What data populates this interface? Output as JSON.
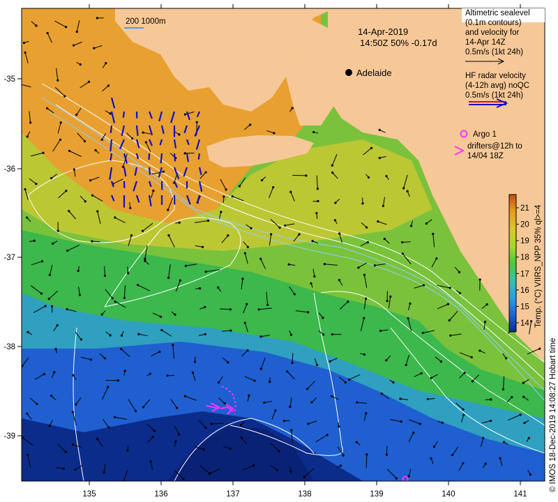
{
  "date_label": "14-Apr-2019",
  "time_label": "14:50Z  50% -0.17d",
  "scale_bar_label": "200  1000m",
  "city": {
    "name": "Adelaide"
  },
  "legend": {
    "altimetric": [
      "Altimetric sealevel",
      "(0.1m contours)",
      "and velocity for",
      "14-Apr 14Z",
      "0.5m/s (1kt 24h)"
    ],
    "hf_radar": [
      "HF radar velocity",
      "(4-12h avg) noQC",
      "0.5m/s (1kt 24h)"
    ],
    "argo": "Argo 1",
    "drifters": [
      "drifters@12h to",
      "14/04 18Z"
    ]
  },
  "colorbar": {
    "label": "Temp. (°C) VIIRS_NPP 35% ql>=4",
    "ticks": [
      "14",
      "15",
      "16",
      "17",
      "18",
      "19",
      "20",
      "21"
    ],
    "colors": [
      "#0b2c8a",
      "#1f5fd0",
      "#2f9fe0",
      "#3cc0a8",
      "#4cc83a",
      "#a6d82a",
      "#d8c828",
      "#e89a20",
      "#c05010"
    ]
  },
  "axes": {
    "x_ticks": [
      "135",
      "136",
      "137",
      "138",
      "139",
      "140",
      "141"
    ],
    "y_ticks": [
      "-35",
      "-36",
      "-37",
      "-38",
      "-39"
    ]
  },
  "credit": "© IMOS 18-Dec-2019 14:08:27 Hobart time",
  "colors": {
    "land": "#f7c897",
    "hf_arrow_red": "#e01010",
    "hf_arrow_blue": "#1010c8",
    "drifter": "#ff30ff"
  }
}
